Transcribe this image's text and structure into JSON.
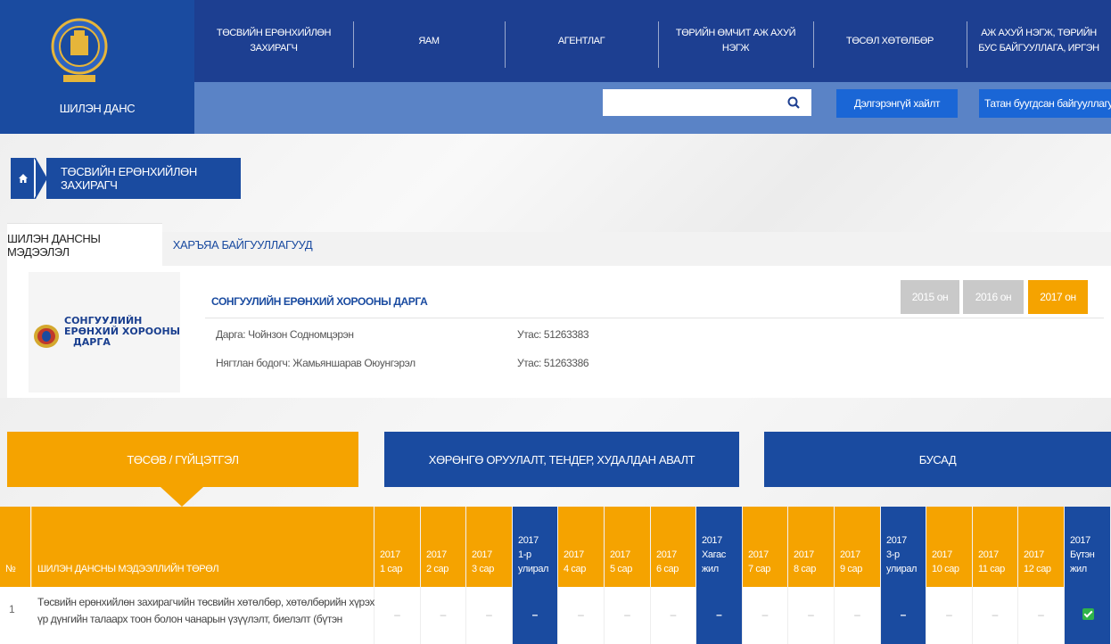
{
  "header": {
    "logo_text": "ШИЛЭН ДАНС",
    "nav": [
      {
        "label": "ТӨСВИЙН ЕРӨНХИЙЛӨН ЗАХИРАГЧ"
      },
      {
        "label": "ЯАМ"
      },
      {
        "label": "АГЕНТЛАГ"
      },
      {
        "label": "ТӨРИЙН ӨМЧИТ АЖ АХУЙ НЭГЖ"
      },
      {
        "label": "ТӨСӨЛ ХӨТӨЛБӨР"
      },
      {
        "label": "АЖ АХУЙ НЭГЖ, ТӨРИЙН БУС БАЙГУУЛЛАГА, ИРГЭН"
      }
    ],
    "search": {
      "value": "",
      "placeholder": ""
    },
    "advanced_search_label": "Дэлгэрэнгүй хайлт",
    "funding_orgs_label": "Татан буугдсан байгууллагууд"
  },
  "breadcrumb": {
    "current": "ТӨСВИЙН ЕРӨНХИЙЛӨН ЗАХИРАГЧ"
  },
  "tabs": [
    {
      "label": "ШИЛЭН ДАНСНЫ МЭДЭЭЛЭЛ"
    },
    {
      "label": "ХАРЪЯА БАЙГУУЛЛАГУУД"
    }
  ],
  "org": {
    "logo_lines": [
      "СОНГУУЛИЙН",
      "ЕРӨНХИЙ ХОРООНЫ",
      "ДАРГА"
    ],
    "title": "СОНГУУЛИЙН ЕРӨНХИЙ ХОРООНЫ ДАРГА",
    "head": "Дарга: Чойнзон Содномцэрэн",
    "head_phone": "Утас: 51263383",
    "accountant": "Нягтлан бодогч: Жамьяншарав Оюунгэрэл",
    "accountant_phone": "Утас: 51263386",
    "years": [
      "2015 он",
      "2016 он",
      "2017 он"
    ]
  },
  "sections": [
    {
      "label": "ТӨСӨВ / ГҮЙЦЭТГЭЛ"
    },
    {
      "label": "ХӨРӨНГӨ ОРУУЛАЛТ, ТЕНДЕР, ХУДАЛДАН АВАЛТ"
    },
    {
      "label": "БУСАД"
    }
  ],
  "table": {
    "no_header": "№",
    "type_header": "ШИЛЭН ДАНСНЫ МЭДЭЭЛЛИЙН ТӨРӨЛ",
    "columns": [
      {
        "year": "2017",
        "period": "1 сар",
        "kind": "month"
      },
      {
        "year": "2017",
        "period": "2 сар",
        "kind": "month"
      },
      {
        "year": "2017",
        "period": "3 сар",
        "kind": "month"
      },
      {
        "year": "2017",
        "period": "1-р улирал",
        "kind": "quarter"
      },
      {
        "year": "2017",
        "period": "4 сар",
        "kind": "month"
      },
      {
        "year": "2017",
        "period": "5 сар",
        "kind": "month"
      },
      {
        "year": "2017",
        "period": "6 сар",
        "kind": "month"
      },
      {
        "year": "2017",
        "period": "Хагас жил",
        "kind": "quarter"
      },
      {
        "year": "2017",
        "period": "7 сар",
        "kind": "month"
      },
      {
        "year": "2017",
        "period": "8 сар",
        "kind": "month"
      },
      {
        "year": "2017",
        "period": "9 сар",
        "kind": "month"
      },
      {
        "year": "2017",
        "period": "3-р улирал",
        "kind": "quarter"
      },
      {
        "year": "2017",
        "period": "10 сар",
        "kind": "month"
      },
      {
        "year": "2017",
        "period": "11 сар",
        "kind": "month"
      },
      {
        "year": "2017",
        "period": "12 сар",
        "kind": "month"
      },
      {
        "year": "2017",
        "period": "Бүтэн жил",
        "kind": "quarter"
      }
    ],
    "rows": [
      {
        "num": "1",
        "text": "Төсвийн ерөнхийлөн захирагчийн төсвийн хөтөлбөр, хөтөлбөрийн хүрэх үр дүнгийн талаарх тоон болон чанарын үзүүлэлт, биелэлт (бүтэн",
        "cells": [
          "–",
          "–",
          "–",
          "–",
          "–",
          "–",
          "–",
          "–",
          "–",
          "–",
          "–",
          "–",
          "–",
          "–",
          "–",
          "✔"
        ]
      }
    ]
  },
  "colors": {
    "navy": "#1d3f91",
    "blue": "#1a4ba0",
    "orange": "#f5a300",
    "light_blue": "#5a83c6"
  }
}
